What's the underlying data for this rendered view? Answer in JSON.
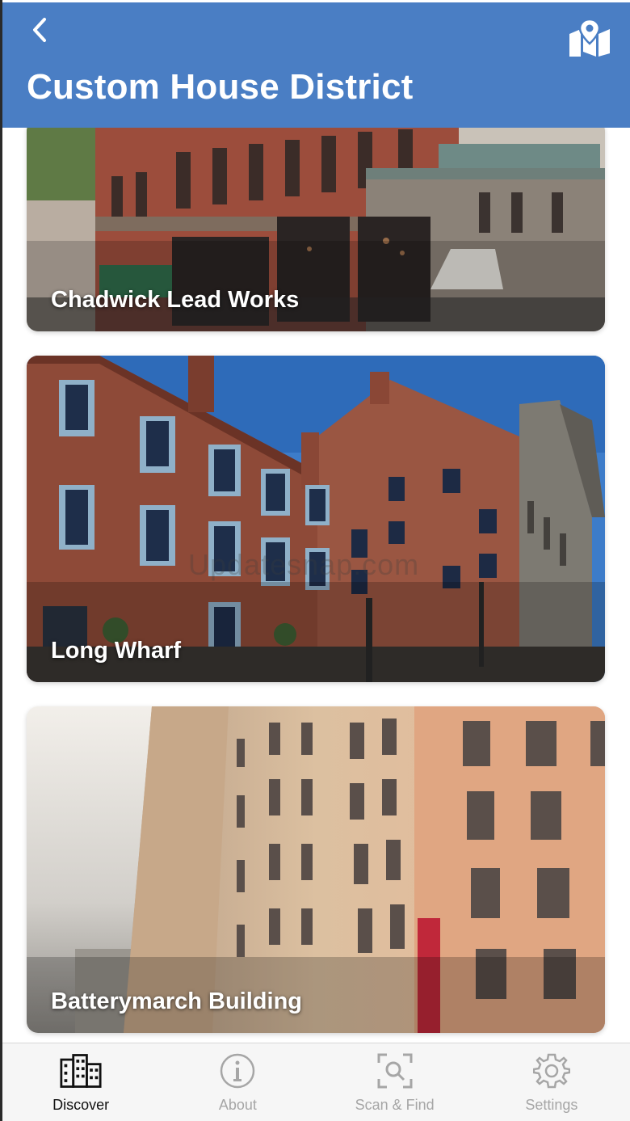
{
  "header": {
    "title": "Custom House District",
    "back_icon": "chevron-left-icon",
    "map_icon": "map-pin-icon",
    "background_color": "#4a7ec4"
  },
  "places": [
    {
      "name": "Chadwick Lead Works"
    },
    {
      "name": "Long Wharf"
    },
    {
      "name": "Batterymarch Building"
    }
  ],
  "watermark": "Updatesnap.com",
  "tabbar": {
    "active_tab": "Discover",
    "tabs": [
      {
        "label": "Discover",
        "icon": "buildings-icon"
      },
      {
        "label": "About",
        "icon": "info-icon"
      },
      {
        "label": "Scan & Find",
        "icon": "scan-search-icon"
      },
      {
        "label": "Settings",
        "icon": "gear-icon"
      }
    ]
  }
}
